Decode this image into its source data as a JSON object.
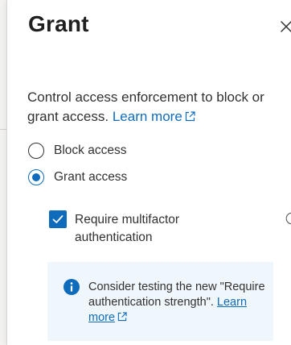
{
  "panel": {
    "title": "Grant",
    "close_icon": "close-icon",
    "description": "Control access enforcement to block or grant access.",
    "learn_more": "Learn more"
  },
  "options": [
    {
      "label": "Block access",
      "selected": false
    },
    {
      "label": "Grant access",
      "selected": true
    }
  ],
  "requirement": {
    "label": "Require multifactor authentication",
    "checked": true,
    "info_icon": "info-icon"
  },
  "notice": {
    "text": "Consider testing the new \"Require authentication strength\".",
    "link": "Learn more",
    "icon": "info-filled-icon"
  },
  "colors": {
    "accent": "#0f6cbd",
    "notice_bg": "#eff6fc",
    "text": "#323130"
  }
}
